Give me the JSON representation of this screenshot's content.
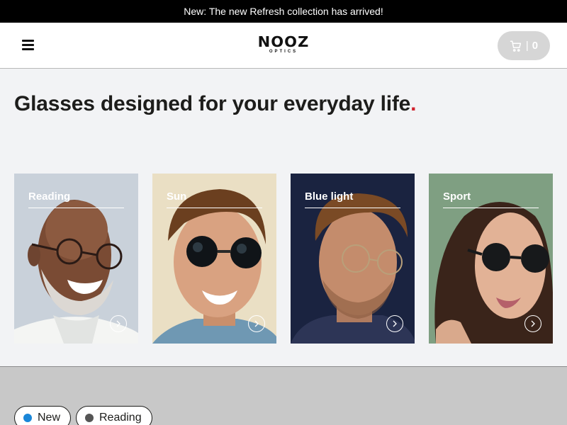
{
  "announcement": "New: The new Refresh collection has arrived!",
  "header": {
    "logo_main": "NOOZ",
    "logo_sub": "OPTICS",
    "cart_separator": "|",
    "cart_count": "0"
  },
  "hero": {
    "title": "Glasses designed for your everyday life",
    "title_dot": "."
  },
  "categories": [
    {
      "label": "Reading",
      "icon": "chevron-right-icon"
    },
    {
      "label": "Sun",
      "icon": "chevron-right-icon"
    },
    {
      "label": "Blue light",
      "icon": "chevron-right-icon"
    },
    {
      "label": "Sport",
      "icon": "chevron-right-icon"
    }
  ],
  "filters": [
    {
      "label": "New",
      "color": "#1a86d8"
    },
    {
      "label": "Reading",
      "color": "#555555"
    }
  ],
  "colors": {
    "accent_dot": "#d0212c"
  }
}
